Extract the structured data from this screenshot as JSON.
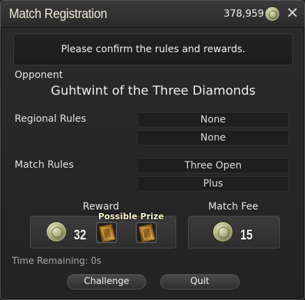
{
  "window": {
    "title": "Match Registration",
    "gil_amount": "378,959",
    "currency_icon": "gil-coin-icon",
    "close_icon": "close-icon"
  },
  "banner": {
    "message": "Please confirm the rules and rewards."
  },
  "opponent": {
    "label": "Opponent",
    "name": "Guhtwint of the Three Diamonds"
  },
  "regional_rules": {
    "label": "Regional Rules",
    "values": [
      "None",
      "None"
    ]
  },
  "match_rules": {
    "label": "Match Rules",
    "values": [
      "Three Open",
      "Plus"
    ]
  },
  "reward": {
    "title": "Reward",
    "coin_quantity": "32",
    "possible_prize_label": "Possible Prize",
    "prize_icons": [
      "card-icon",
      "card-icon"
    ]
  },
  "match_fee": {
    "title": "Match Fee",
    "coin_quantity": "15"
  },
  "time_remaining": "Time Remaining: 0s",
  "buttons": {
    "challenge": "Challenge",
    "quit": "Quit"
  }
}
